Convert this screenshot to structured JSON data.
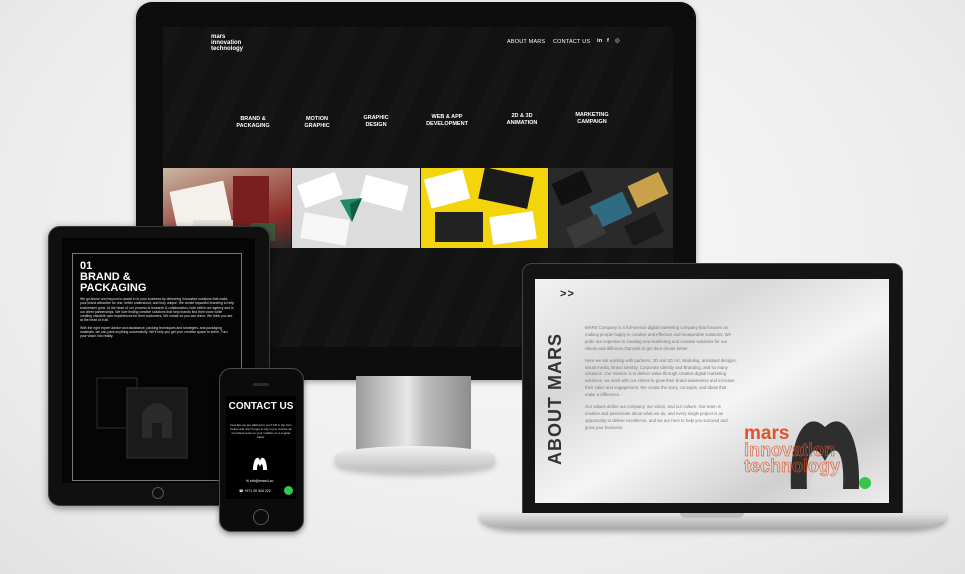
{
  "desktop": {
    "logo": [
      "mars",
      "innovation",
      "technology"
    ],
    "nav": [
      "ABOUT MARS",
      "CONTACT US"
    ],
    "social_icons": [
      "linkedin-icon",
      "facebook-icon",
      "instagram-icon"
    ],
    "social_glyphs": [
      "in",
      "f",
      "◎"
    ],
    "services": [
      [
        "BRAND &",
        "PACKAGING"
      ],
      [
        "MOTION",
        "GRAPHIC"
      ],
      [
        "GRAPHIC",
        "DESIGN"
      ],
      [
        "WEB & APP",
        "DEVELOPMENT"
      ],
      [
        "2D & 3D",
        "ANIMATION"
      ],
      [
        "MARKETING",
        "CAMPAIGN"
      ]
    ]
  },
  "tablet": {
    "number": "01",
    "title": "BRAND & PACKAGING",
    "paragraph1": "We go above and beyond to assist in to your business by delivering innovative solutions that make your brand attractive for one, better understood, and truly unique. We create impactful branding to help businesses grow. At the heart of our process is research & collaboration, both within our agency and in our client partnerships. We love finding creative solutions that help brands find their voice while creating valuable user experiences for their customers. We create so you can shine. We think you are at the heart of it all.",
    "paragraph2": "With the right expert advice and assistance, packing techniques and strategies, and packaging materials, we can pack anything successfully. We'll help you get your creative space to shine. Turn your vision into reality."
  },
  "phone": {
    "title": "CONTACT US",
    "text": "Feel like we are talking for you? Fill in the form below and don't forget to sign up to receive all our latest news on your mailbox on a regular basis.",
    "email": "info@mars4.co",
    "phone": "+971 00 444 222"
  },
  "laptop": {
    "arrows": "> >",
    "heading": "ABOUT MARS",
    "paragraph1": "MARS Company is a full-service digital marketing company that focuses on making people happy in creative and effective and measurable solutions. We pride our expertise in creating new marketing and creative solutions for our clients and different channels to get their clients better.",
    "paragraph2": "Here we are working with partners, 3D and 2D Art, Modeling, animated designs, visual media, Brand Identity, Corporate Identity and Branding, and so many solutions. Our mission is to deliver value through creative digital marketing solutions, we work with our clients to grow their brand awareness and increase their sales and engagement. We create the story, concepts, and ideas that make a difference.",
    "paragraph3": "Our values define our company, our vision, and our culture. Our team is creative and passionate about what we do, and every single project is an opportunity to deliver excellence, and we are here to help you succeed and grow your business.",
    "brand_line1": "mars",
    "brand_line2": "innovation",
    "brand_line3": "technology"
  },
  "colors": {
    "accent": "#e0522a",
    "whatsapp": "#35c74b"
  }
}
